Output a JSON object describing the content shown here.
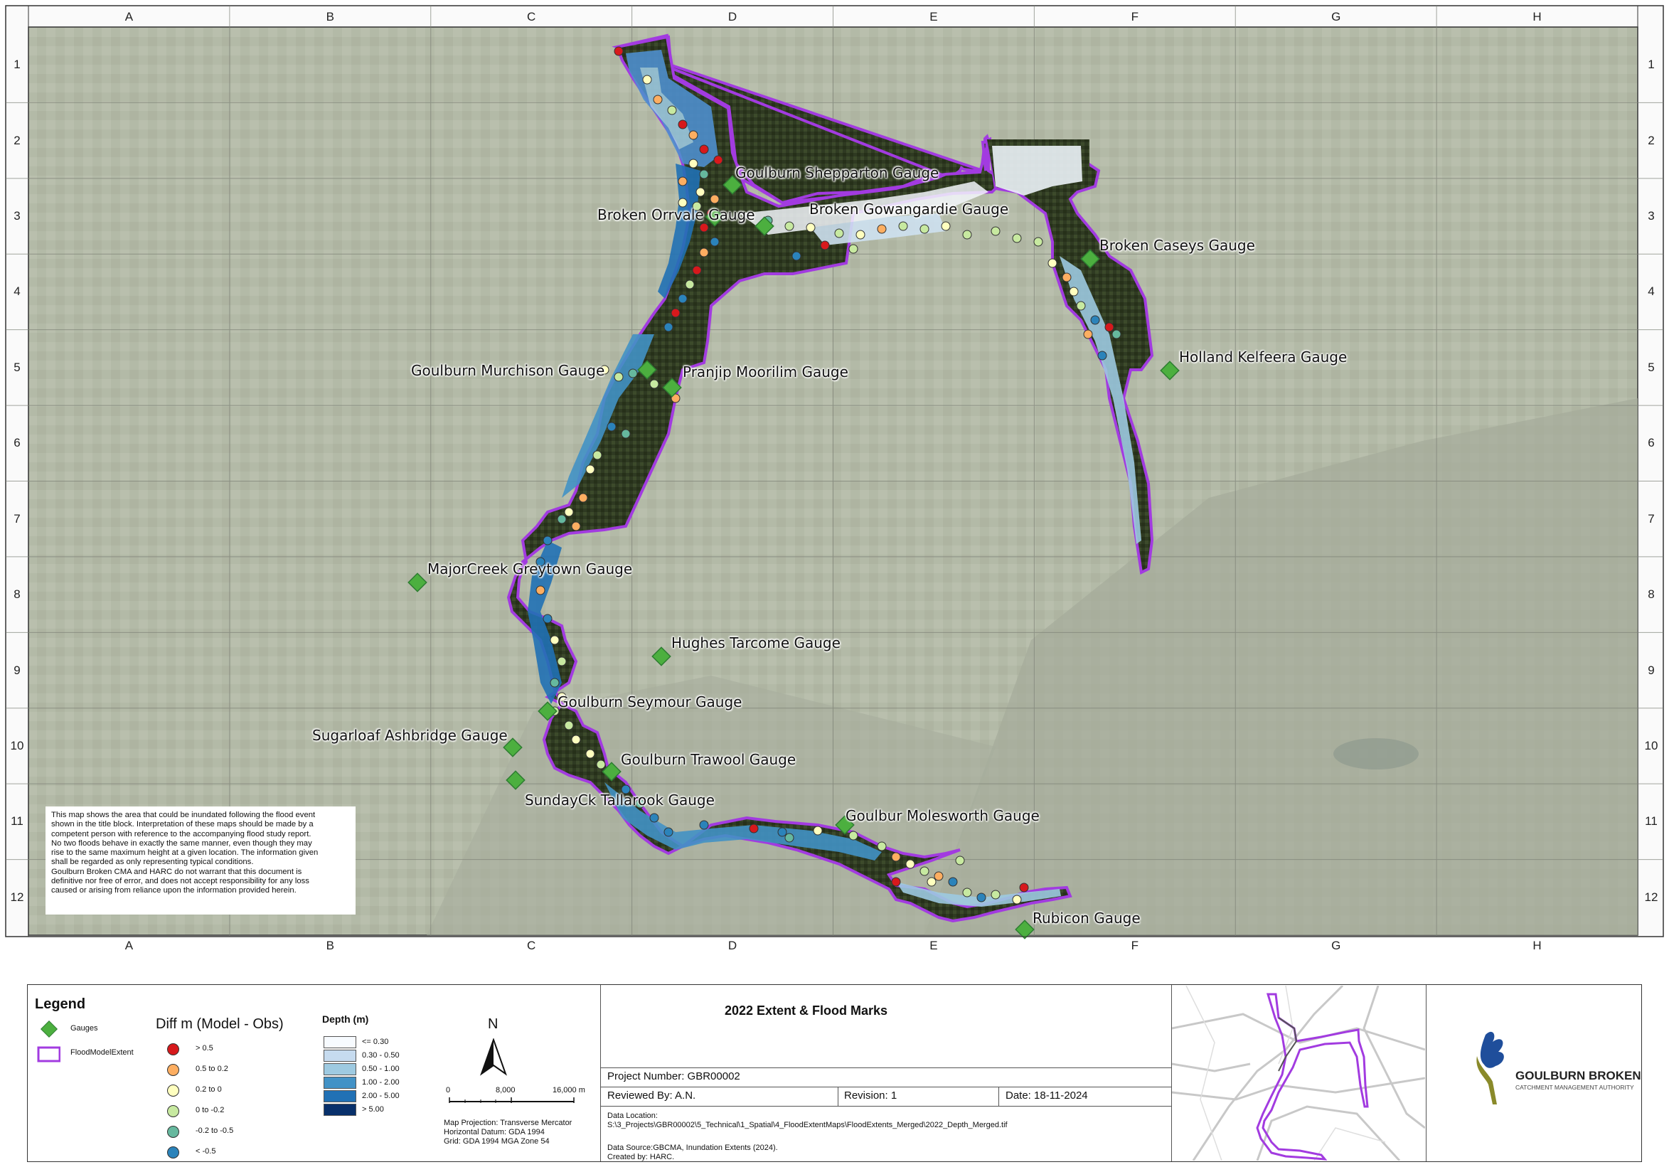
{
  "grid": {
    "columns": [
      "A",
      "B",
      "C",
      "D",
      "E",
      "F",
      "G",
      "H"
    ],
    "rows": [
      "1",
      "2",
      "3",
      "4",
      "5",
      "6",
      "7",
      "8",
      "9",
      "10",
      "11",
      "12"
    ]
  },
  "gauges": [
    {
      "label": "Goulburn Shepparton Gauge"
    },
    {
      "label": "Broken Orrvale Gauge"
    },
    {
      "label": "Broken Gowangardie Gauge"
    },
    {
      "label": "Broken Caseys Gauge"
    },
    {
      "label": "Holland Kelfeera Gauge"
    },
    {
      "label": "Goulburn Murchison Gauge"
    },
    {
      "label": "Pranjip Moorilim Gauge"
    },
    {
      "label": "MajorCreek Greytown Gauge"
    },
    {
      "label": "Hughes Tarcome  Gauge"
    },
    {
      "label": "Goulburn Seymour Gauge"
    },
    {
      "label": "Sugarloaf Ashbridge Gauge"
    },
    {
      "label": "Goulburn Trawool Gauge"
    },
    {
      "label": "SundayCk Tallarook Gauge"
    },
    {
      "label": "Goulbur Molesworth Gauge"
    },
    {
      "label": "Rubicon Gauge"
    }
  ],
  "disclaimer": [
    "This map shows the area that could be inundated following the flood event",
    "shown in the title block. Interpretation of these maps should be made by a",
    "competent person with reference to the accompanying flood study report.",
    "No two floods behave in exactly the same manner, even though they may",
    "rise to the same maximum height at a given location. The information given",
    "shall be regarded as only representing typical conditions.",
    "Goulburn Broken CMA and HARC do not warrant that this document is",
    "definitive nor free of error, and does not accept responsibility for any loss",
    "caused or arising from reliance upon the information provided herein."
  ],
  "legend": {
    "heading": "Legend",
    "gauges_label": "Gauges",
    "extent_label": "FloodModelExtent",
    "gauge_color": "#4caf3f",
    "extent_color": "#a23be0",
    "diff_title": "Diff m (Model - Obs)",
    "diff_classes": [
      {
        "label": " > 0.5",
        "color": "#d7191c"
      },
      {
        "label": "0.5 to 0.2",
        "color": "#fdae61"
      },
      {
        "label": "0.2 to 0",
        "color": "#ffffbf"
      },
      {
        "label": "0 to -0.2",
        "color": "#c7e9a0"
      },
      {
        "label": "-0.2 to -0.5",
        "color": "#66b89e"
      },
      {
        "label": "< -0.5",
        "color": "#2b83ba"
      }
    ],
    "depth_title": "Depth (m)",
    "depth_classes": [
      {
        "label": "<= 0.30",
        "color": "#f7fbff"
      },
      {
        "label": "0.30 - 0.50",
        "color": "#c6dbef"
      },
      {
        "label": "0.50 - 1.00",
        "color": "#9ecae1"
      },
      {
        "label": "1.00 - 2.00",
        "color": "#4292c6"
      },
      {
        "label": "2.00 - 5.00",
        "color": "#2171b5"
      },
      {
        "label": "> 5.00",
        "color": "#08306b"
      }
    ]
  },
  "north_arrow": "N",
  "scale_bar": {
    "ticks": [
      "0",
      "8,000",
      "16,000 m"
    ]
  },
  "projection": [
    "Map Projection: Transverse Mercator",
    "Horizontal Datum: GDA 1994",
    "Grid: GDA 1994 MGA Zone 54"
  ],
  "title_block": {
    "title": "2022 Extent & Flood Marks",
    "project_number": "Project Number: GBR00002",
    "reviewed_by": "Reviewed By: A.N.",
    "revision": "Revision: 1",
    "date": "Date: 18-11-2024",
    "data_location_label": "Data Location:",
    "data_location_path": "S:\\3_Projects\\GBR00002\\5_Technical\\1_Spatial\\4_FloodExtentMaps\\FloodExtents_Merged\\2022_Depth_Merged.tif",
    "data_source": "Data Source:GBCMA, Inundation Extents (2024).",
    "created_by": "Created by: HARC."
  },
  "logo": {
    "name": "GOULBURN BROKEN",
    "subtitle": "CATCHMENT MANAGEMENT AUTHORITY"
  }
}
